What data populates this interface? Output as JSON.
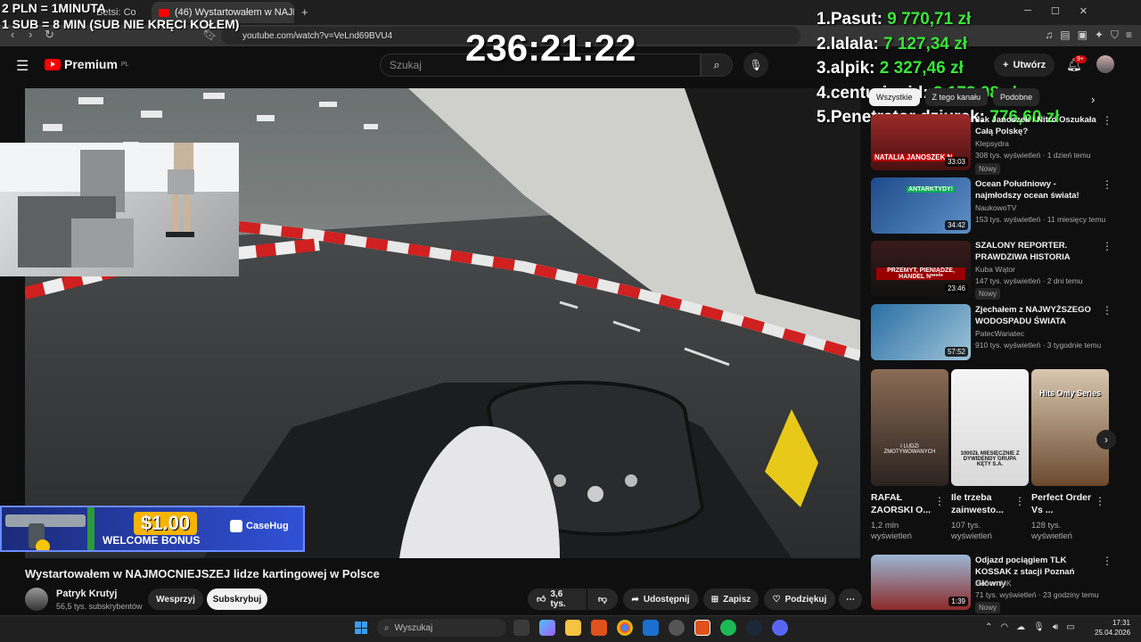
{
  "browser": {
    "tabs": [
      {
        "label": "Betsi: Co"
      },
      {
        "label": "(46) Wystartowałem w NAJM"
      }
    ],
    "new_tab": "+",
    "url": "youtube.com/watch?v=VeLnd69BVU4"
  },
  "stream_overlay": {
    "rates": [
      "2 PLN = 1MINUTA",
      "1 SUB = 8 MIN (SUB NIE KRĘCI KOŁEM)"
    ],
    "timer": "236:21:22",
    "leaderboard": [
      {
        "rank": "1.",
        "name": "Pasut:",
        "amount": "9 770,71 zł"
      },
      {
        "rank": "2.",
        "name": "lalala:",
        "amount": "7 127,34 zł"
      },
      {
        "rank": "3.",
        "name": "alpik:",
        "amount": "2 327,46 zł"
      },
      {
        "rank": "4.",
        "name": "centurionid:",
        "amount": "2 172,08 zł"
      },
      {
        "rank": "5.",
        "name": "Penetrator dziurek:",
        "amount": "776,60 zł"
      }
    ],
    "banner": {
      "amount": "$1.00",
      "text": "WELCOME BONUS",
      "brand": "CaseHug"
    }
  },
  "youtube": {
    "logo": "Premium",
    "logo_region": "PL",
    "search_placeholder": "Szukaj",
    "create_label": "Utwórz",
    "notification_count": "9+",
    "video": {
      "title": "Wystartowałem w NAJMOCNIEJSZEJ lidze kartingowej w Polsce",
      "channel": "Patryk Krutyj",
      "subscribers": "56,5 tys. subskrybentów",
      "support_label": "Wesprzyj",
      "subscribe_label": "Subskrybuj",
      "likes": "3,6 tys.",
      "share_label": "Udostępnij",
      "save_label": "Zapisz",
      "thanks_label": "Podziękuj"
    },
    "chips": [
      "Wszystkie",
      "Z tego kanału",
      "Podobne"
    ],
    "recommendations": [
      {
        "title": "Jak Janoszek i Nitro Oszukała Całą Polskę?",
        "channel": "Klepsydra",
        "meta": "308 tys. wyświetleń · 1 dzień temu",
        "duration": "33:03",
        "new": "Nowy",
        "thumb_text": "NATALIA JANOSZEK N"
      },
      {
        "title": "Ocean Południowy - najmłodszy ocean świata!",
        "channel": "NaukowoTV",
        "meta": "153 tys. wyświetleń · 11 miesięcy temu",
        "duration": "34:42",
        "thumb_text": "ANTARKTYDY!"
      },
      {
        "title": "SZALONY REPORTER. PRAWDZIWA HISTORIA",
        "channel": "Kuba Wątor",
        "meta": "147 tys. wyświetleń · 2 dni temu",
        "duration": "23:46",
        "new": "Nowy",
        "thumb_text": "PRZEMYT, PIENIĄDZE, HANDEL N*****"
      },
      {
        "title": "Zjechałem z NAJWYŻSZEGO WODOSPADU ŚWIATA",
        "channel": "PatecWariatec",
        "meta": "910 tys. wyświetleń · 3 tygodnie temu",
        "duration": "57:52"
      },
      {
        "title": "Odjazd pociągiem TLK KOSSAK z stacji Poznań Główny",
        "channel": "Hubert MK",
        "meta": "71 tys. wyświetleń · 23 godziny temu",
        "duration": "1:39",
        "new": "Nowy"
      }
    ],
    "shorts": [
      {
        "title": "RAFAŁ ZAORSKI O...",
        "views": "1,2 mln wyświetleń",
        "thumb_text": "I LUDZI ZMOTYWOWANYCH"
      },
      {
        "title": "Ile trzeba zainwesto...",
        "views": "107 tys. wyświetleń",
        "thumb_text": "1000ZŁ MIESIĘCZNIE Z DYWIDENDY GRUPA KĘTY S.A."
      },
      {
        "title": "Perfect Order Vs ...",
        "views": "128 tys. wyświetleń",
        "thumb_text": "Hits Only Series"
      }
    ]
  },
  "taskbar": {
    "search_placeholder": "Wyszukaj",
    "time": "17:31",
    "date": "25.04.2026"
  }
}
